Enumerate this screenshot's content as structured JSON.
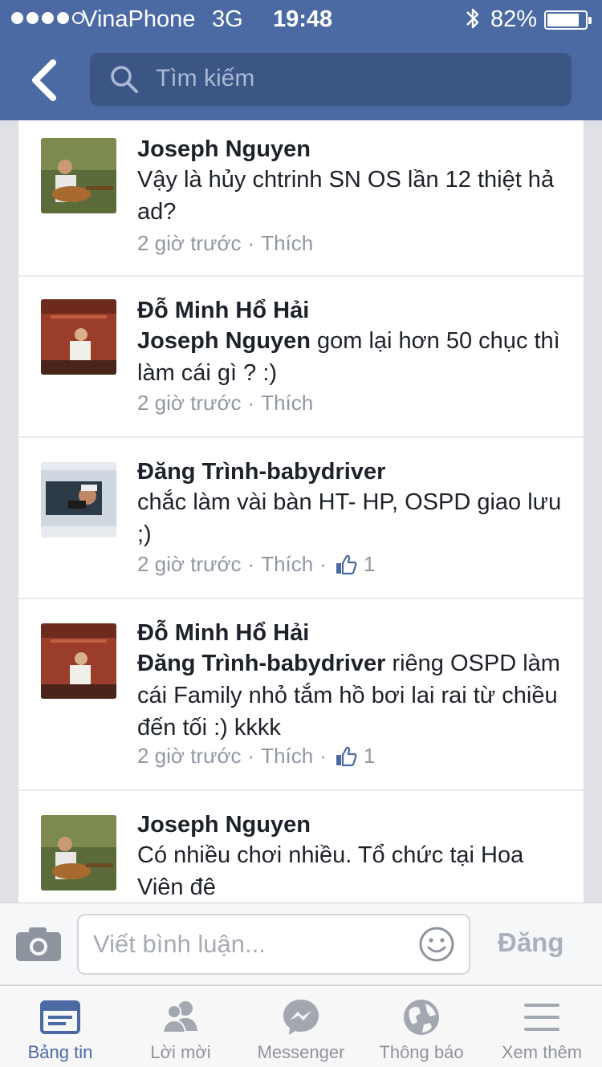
{
  "status_bar": {
    "carrier": "VinaPhone",
    "network": "3G",
    "time": "19:48",
    "battery": "82%",
    "battery_level": 0.82
  },
  "search": {
    "placeholder": "Tìm kiếm"
  },
  "comments": [
    {
      "name": "Joseph Nguyen",
      "mention": "",
      "text": "Vậy là hủy chtrinh SN OS lần 12 thiệt hả ad?",
      "time": "2 giờ trước",
      "like": "Thích",
      "likes": ""
    },
    {
      "name": "Đỗ Minh Hổ Hải",
      "mention": "Joseph Nguyen",
      "text": " gom lại hơn 50 chục thì làm cái gì ? :)",
      "time": "2 giờ trước",
      "like": "Thích",
      "likes": ""
    },
    {
      "name": "Đăng Trình-babydriver",
      "mention": "",
      "text": "chắc làm vài bàn HT- HP, OSPD giao lưu ;)",
      "time": "2 giờ trước",
      "like": "Thích",
      "likes": "1"
    },
    {
      "name": "Đỗ Minh Hổ Hải",
      "mention": "Đăng Trình-babydriver",
      "text": " riêng OSPD làm cái Family nhỏ tắm hồ bơi lai rai từ chiều đến tối :) kkkk",
      "time": "2 giờ trước",
      "like": "Thích",
      "likes": "1"
    },
    {
      "name": "Joseph Nguyen",
      "mention": "",
      "text": "Có nhiều chơi nhiều. Tổ chức tại Hoa Viên đê",
      "time": "",
      "like": "",
      "likes": ""
    }
  ],
  "composer": {
    "placeholder": "Viết bình luận...",
    "post_label": "Đăng"
  },
  "tabs": [
    {
      "label": "Bảng tin",
      "icon": "news-feed-icon"
    },
    {
      "label": "Lời mời",
      "icon": "friend-requests-icon"
    },
    {
      "label": "Messenger",
      "icon": "messenger-icon"
    },
    {
      "label": "Thông báo",
      "icon": "globe-icon"
    },
    {
      "label": "Xem thêm",
      "icon": "menu-icon"
    }
  ],
  "colors": {
    "header": "#4b6aa3",
    "search_bg": "#3b5584",
    "active_tab": "#4b6aa3",
    "meta_text": "#9197a3"
  }
}
